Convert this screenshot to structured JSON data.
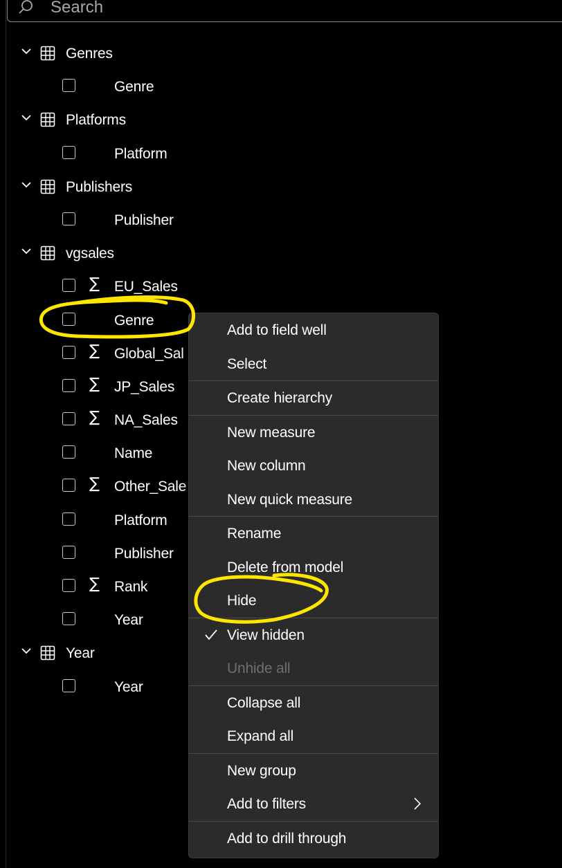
{
  "search": {
    "placeholder": "Search",
    "icon": "search-icon"
  },
  "tree": {
    "groups": [
      {
        "name": "Genres",
        "icon": "table-icon",
        "fields": [
          {
            "label": "Genre",
            "sigma": false
          }
        ]
      },
      {
        "name": "Platforms",
        "icon": "table-icon",
        "fields": [
          {
            "label": "Platform",
            "sigma": false
          }
        ]
      },
      {
        "name": "Publishers",
        "icon": "table-icon",
        "fields": [
          {
            "label": "Publisher",
            "sigma": false
          }
        ]
      },
      {
        "name": "vgsales",
        "icon": "table-icon",
        "fields": [
          {
            "label": "EU_Sales",
            "sigma": true
          },
          {
            "label": "Genre",
            "sigma": false
          },
          {
            "label": "Global_Sal",
            "sigma": true
          },
          {
            "label": "JP_Sales",
            "sigma": true
          },
          {
            "label": "NA_Sales",
            "sigma": true
          },
          {
            "label": "Name",
            "sigma": false
          },
          {
            "label": "Other_Sale",
            "sigma": true
          },
          {
            "label": "Platform",
            "sigma": false
          },
          {
            "label": "Publisher",
            "sigma": false
          },
          {
            "label": "Rank",
            "sigma": true
          },
          {
            "label": "Year",
            "sigma": false
          }
        ]
      },
      {
        "name": "Year",
        "icon": "table-icon",
        "fields": [
          {
            "label": "Year",
            "sigma": false
          }
        ]
      }
    ],
    "sigma_symbol": "∑"
  },
  "context_menu": {
    "sections": [
      [
        {
          "label": "Add to field well"
        },
        {
          "label": "Select"
        }
      ],
      [
        {
          "label": "Create hierarchy"
        }
      ],
      [
        {
          "label": "New measure"
        },
        {
          "label": "New column"
        },
        {
          "label": "New quick measure"
        }
      ],
      [
        {
          "label": "Rename"
        },
        {
          "label": "Delete from model"
        },
        {
          "label": "Hide"
        }
      ],
      [
        {
          "label": "View hidden",
          "checked": true
        },
        {
          "label": "Unhide all",
          "disabled": true
        }
      ],
      [
        {
          "label": "Collapse all"
        },
        {
          "label": "Expand all"
        }
      ],
      [
        {
          "label": "New group"
        },
        {
          "label": "Add to filters",
          "submenu": true
        }
      ],
      [
        {
          "label": "Add to drill through"
        }
      ]
    ]
  },
  "colors": {
    "background": "#000000",
    "menu_background": "#2b2b2b",
    "annotation": "#ffe600",
    "disabled_text": "#6e6e6e"
  }
}
